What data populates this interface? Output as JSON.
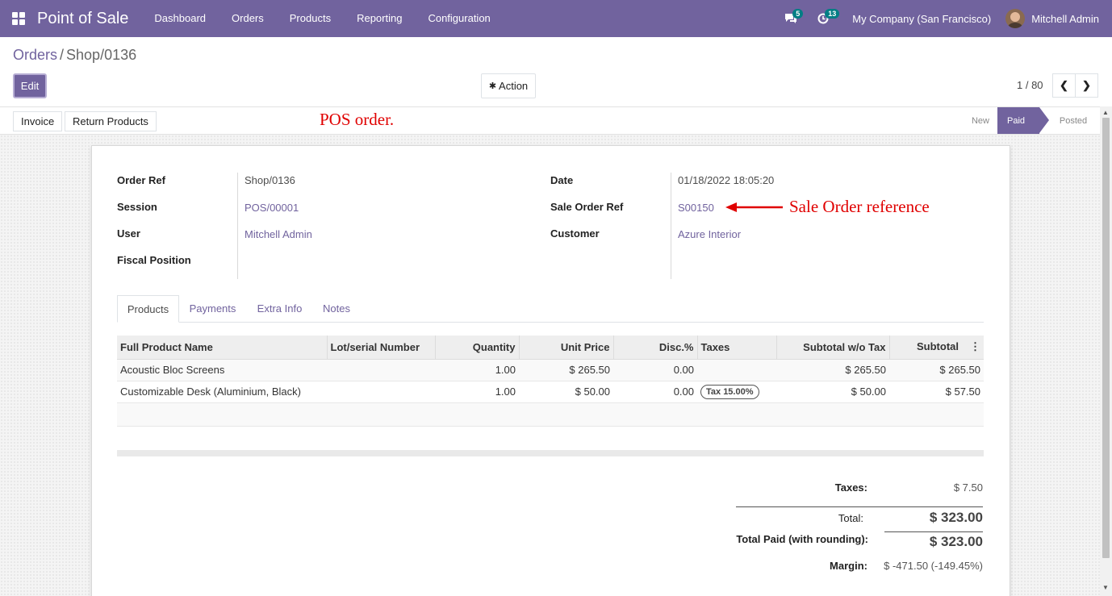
{
  "navbar": {
    "app_title": "Point of Sale",
    "menu": [
      "Dashboard",
      "Orders",
      "Products",
      "Reporting",
      "Configuration"
    ],
    "messages_count": "5",
    "activities_count": "13",
    "company": "My Company (San Francisco)",
    "user": "Mitchell Admin",
    "color": "#71639e"
  },
  "breadcrumb": {
    "parent": "Orders",
    "separator": "/",
    "current": "Shop/0136"
  },
  "controls": {
    "edit_label": "Edit",
    "action_label": "Action",
    "pager_value": "1 / 80"
  },
  "statusbar": {
    "buttons": [
      "Invoice",
      "Return Products"
    ],
    "stages": [
      "New",
      "Paid",
      "Posted"
    ],
    "active_stage": "Paid"
  },
  "annotations": {
    "pos_order": "POS order.",
    "sale_order_ref": "Sale Order reference",
    "color": "#e00000"
  },
  "form": {
    "order_ref_label": "Order Ref",
    "order_ref": "Shop/0136",
    "session_label": "Session",
    "session": "POS/00001",
    "user_label": "User",
    "user": "Mitchell Admin",
    "fiscal_position_label": "Fiscal Position",
    "date_label": "Date",
    "date": "01/18/2022 18:05:20",
    "sale_order_ref_label": "Sale Order Ref",
    "sale_order_ref": "S00150",
    "customer_label": "Customer",
    "customer": "Azure Interior"
  },
  "tabs": [
    "Products",
    "Payments",
    "Extra Info",
    "Notes"
  ],
  "table": {
    "headers": [
      "Full Product Name",
      "Lot/serial Number",
      "Quantity",
      "Unit Price",
      "Disc.%",
      "Taxes",
      "Subtotal w/o Tax",
      "Subtotal"
    ],
    "rows": [
      {
        "name": "Acoustic Bloc Screens",
        "lot": "",
        "qty": "1.00",
        "unit_price": "$ 265.50",
        "disc": "0.00",
        "taxes": "",
        "subtotal_wo_tax": "$ 265.50",
        "subtotal": "$ 265.50"
      },
      {
        "name": "Customizable Desk (Aluminium, Black)",
        "lot": "",
        "qty": "1.00",
        "unit_price": "$ 50.00",
        "disc": "0.00",
        "taxes": "Tax 15.00%",
        "subtotal_wo_tax": "$ 50.00",
        "subtotal": "$ 57.50"
      }
    ]
  },
  "totals": {
    "taxes_label": "Taxes:",
    "taxes": "$ 7.50",
    "total_label": "Total:",
    "total": "$ 323.00",
    "total_paid_label": "Total Paid (with rounding):",
    "total_paid": "$ 323.00",
    "margin_label": "Margin:",
    "margin": "$ -471.50 (-149.45%)"
  }
}
